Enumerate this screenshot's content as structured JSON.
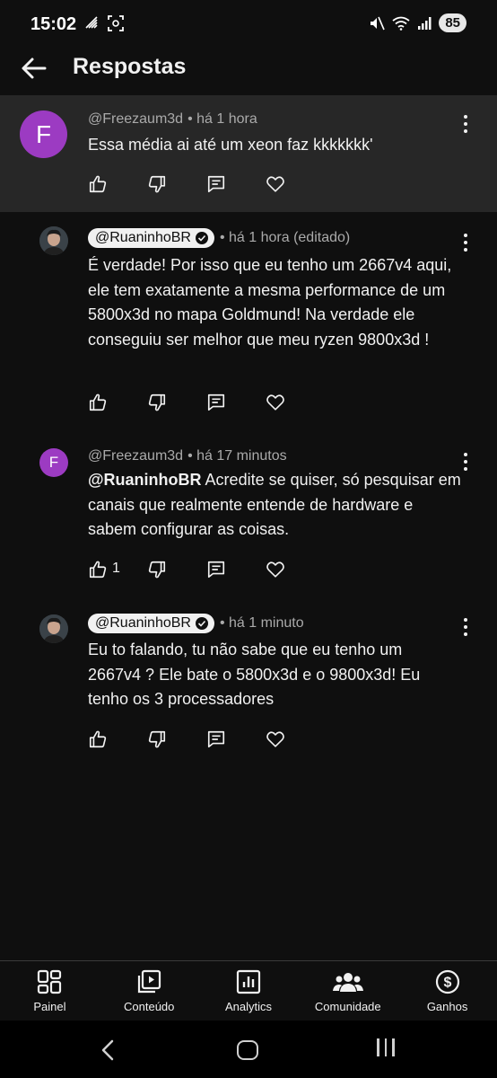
{
  "status_bar": {
    "time": "15:02",
    "battery": "85"
  },
  "header": {
    "title": "Respostas"
  },
  "comments": [
    {
      "avatar_letter": "F",
      "handle": "@Freezaum3d",
      "time": "• há 1 hora",
      "text": "Essa média ai até um xeon faz kkkkkkk'",
      "likes": ""
    },
    {
      "handle": "@RuaninhoBR",
      "time": "• há 1 hora (editado)",
      "text": "É verdade! Por isso que eu tenho um 2667v4 aqui, ele tem exatamente a mesma performance de um 5800x3d no mapa Goldmund! Na verdade ele conseguiu ser melhor que meu ryzen 9800x3d !",
      "likes": ""
    },
    {
      "avatar_letter": "F",
      "handle": "@Freezaum3d",
      "time": "• há 17 minutos",
      "mention": "@RuaninhoBR",
      "text": " Acredite se quiser, só pesquisar em canais que realmente entende de hardware e sabem configurar as coisas.",
      "likes": "1"
    },
    {
      "handle": "@RuaninhoBR",
      "time": "• há 1 minuto",
      "text": "Eu to falando, tu não sabe que eu tenho um 2667v4 ? Ele bate o 5800x3d e o 9800x3d! Eu tenho os 3 processadores",
      "likes": ""
    }
  ],
  "bottom_nav": [
    {
      "label": "Painel",
      "icon": "dashboard-icon"
    },
    {
      "label": "Conteúdo",
      "icon": "content-icon"
    },
    {
      "label": "Analytics",
      "icon": "analytics-icon"
    },
    {
      "label": "Comunidade",
      "icon": "community-icon"
    },
    {
      "label": "Ganhos",
      "icon": "earnings-icon"
    }
  ],
  "colors": {
    "background": "#0f0f0f",
    "highlight": "#272727",
    "avatar": "#9c3bc2",
    "muted": "#aaaaaa"
  }
}
